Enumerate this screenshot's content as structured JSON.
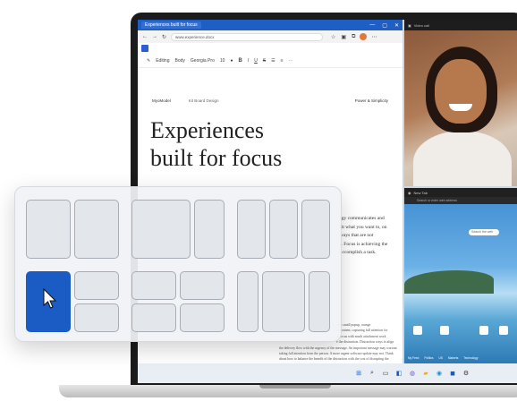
{
  "browser": {
    "tab_title": "Experiences built for focus",
    "address": "www.experience.docx",
    "window_controls": [
      "—",
      "▢",
      "✕"
    ]
  },
  "toolbar": {
    "editing_label": "Editing",
    "style_label": "Body",
    "font_label": "Georgia Pro",
    "size_label": "10",
    "bold": "B",
    "italic": "I",
    "underline": "U",
    "strike": "S"
  },
  "document": {
    "header_left": "MyoModel",
    "header_mid": "Kit Board Design",
    "header_right": "Power & Simplicity",
    "title_line1": "Experiences",
    "title_line2": "built for focus",
    "para_lines": [
      "rgy communicates and",
      "fit what you want to, on",
      "ways that are not",
      "r. Focus is achieving the",
      "accomplish a task."
    ],
    "small_lines": [
      "on a small popup, orange",
      "ce content, capturing full attention for",
      "nt focus with much attachment work",
      "e the distraction. Distraction ways to align",
      "the delivery flow with the urgency of the message. An important message may warrant",
      "taking full attention from the person. A more urgent software update may not. Think",
      "about how to balance the benefit of the distraction with the cost of disrupting the"
    ]
  },
  "video_call": {
    "title": "Video call"
  },
  "desktop": {
    "title": "New Tab",
    "address": "Search or enter web address",
    "search_placeholder": "Search the web",
    "categories": [
      "My Feed",
      "Politics",
      "US",
      "Markets",
      "Technology",
      "Entertainment"
    ]
  },
  "snap_layouts": {
    "selected_layout": "half-left",
    "accent": "#1a5cc4"
  },
  "taskbar": {
    "icons": [
      "windows-icon",
      "search-icon",
      "task-view-icon",
      "widgets-icon",
      "chat-icon",
      "file-explorer-icon",
      "edge-icon",
      "store-icon",
      "settings-icon"
    ]
  }
}
